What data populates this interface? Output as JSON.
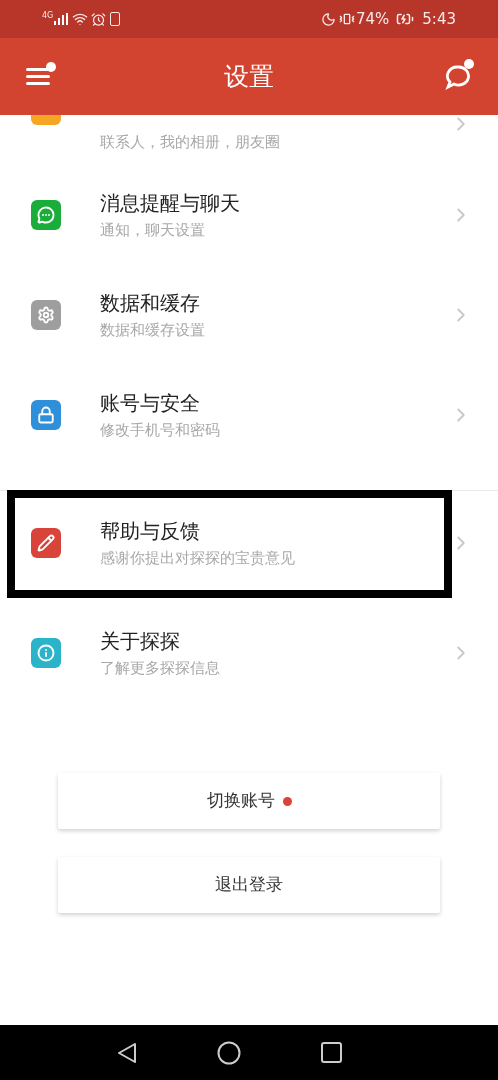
{
  "status_bar": {
    "network": "4G",
    "battery": "74%",
    "time": "5:43"
  },
  "header": {
    "title": "设置",
    "menu_badge": true,
    "chat_badge": true
  },
  "settings_items": [
    {
      "kind": "clipped",
      "color": "#f5a623",
      "subtitle": "联系人，我的相册，朋友圈"
    },
    {
      "kind": "full",
      "color": "#1aad3a",
      "title": "消息提醒与聊天",
      "subtitle": "通知，聊天设置",
      "highlighted": false
    },
    {
      "kind": "full",
      "color": "#9e9e9e",
      "title": "数据和缓存",
      "subtitle": "数据和缓存设置",
      "highlighted": false
    },
    {
      "kind": "full",
      "color": "#2f8fd8",
      "title": "账号与安全",
      "subtitle": "修改手机号和密码",
      "highlighted": false
    },
    {
      "kind": "full",
      "color": "#d9443a",
      "title": "帮助与反馈",
      "subtitle": "感谢你提出对探探的宝贵意见",
      "highlighted": true
    },
    {
      "kind": "full",
      "color": "#2bb3c9",
      "title": "关于探探",
      "subtitle": "了解更多探探信息",
      "highlighted": false
    }
  ],
  "buttons": [
    {
      "label": "切换账号",
      "badge": true
    },
    {
      "label": "退出登录",
      "badge": false
    }
  ]
}
